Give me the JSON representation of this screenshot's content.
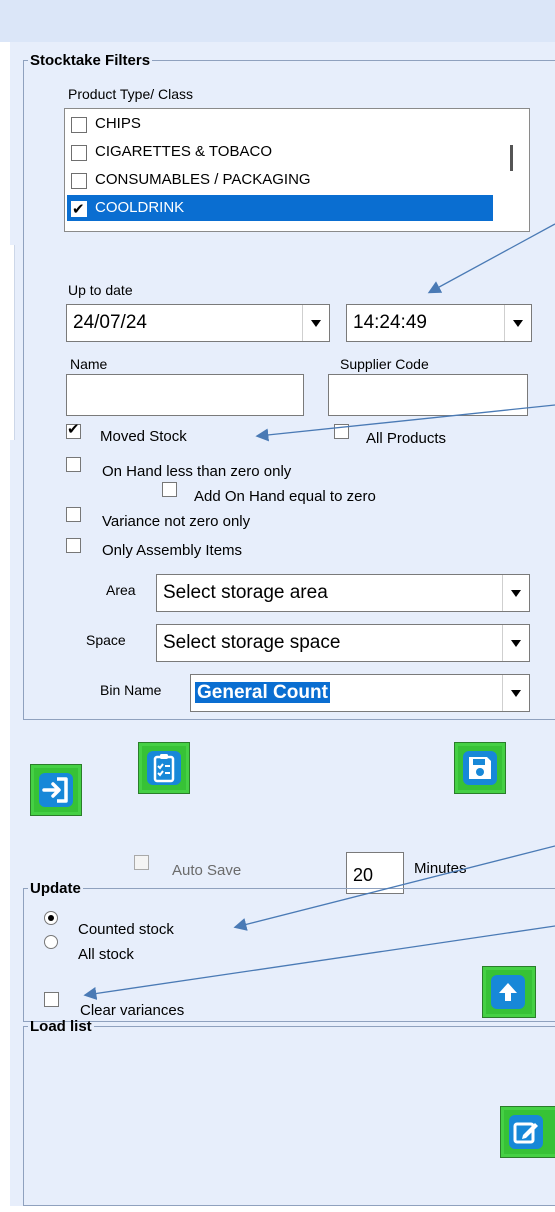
{
  "filters": {
    "legend": "Stocktake Filters",
    "product_type_label": "Product Type/ Class",
    "product_types": [
      {
        "label": "CHIPS",
        "checked": false,
        "selected": false
      },
      {
        "label": "CIGARETTES & TOBACO",
        "checked": false,
        "selected": false
      },
      {
        "label": "CONSUMABLES / PACKAGING",
        "checked": false,
        "selected": false
      },
      {
        "label": "COOLDRINK",
        "checked": true,
        "selected": true
      }
    ],
    "up_to_date_label": "Up to date",
    "date_value": "24/07/24",
    "time_value": "14:24:49",
    "name_label": "Name",
    "name_value": "",
    "supplier_code_label": "Supplier Code",
    "supplier_code_value": "",
    "options": {
      "moved_stock": {
        "label": "Moved Stock",
        "checked": true
      },
      "all_products": {
        "label": "All Products",
        "checked": false
      },
      "on_hand_less_zero": {
        "label": "On Hand less than zero only",
        "checked": false
      },
      "add_on_hand_zero": {
        "label": "Add On Hand equal to zero",
        "checked": false
      },
      "variance_not_zero": {
        "label": "Variance not zero only",
        "checked": false
      },
      "only_assembly": {
        "label": "Only Assembly Items",
        "checked": false
      }
    },
    "area_label": "Area",
    "area_value": "Select storage area",
    "space_label": "Space",
    "space_value": "Select storage space",
    "bin_name_label": "Bin Name",
    "bin_name_value": "General Count"
  },
  "toolbar": {
    "buttons": [
      {
        "name": "import-button",
        "icon": "sign-in-icon"
      },
      {
        "name": "checklist-button",
        "icon": "clipboard-checklist-icon"
      },
      {
        "name": "save-button",
        "icon": "floppy-disk-icon"
      }
    ]
  },
  "autosave": {
    "label": "Auto Save",
    "checked": false,
    "minutes_value": "20",
    "minutes_label": "Minutes"
  },
  "update": {
    "legend": "Update",
    "counted_stock_label": "Counted stock",
    "all_stock_label": "All stock",
    "selected": "counted",
    "clear_variances_label": "Clear variances",
    "clear_variances_checked": false,
    "upload_icon": "upload-icon"
  },
  "load_list": {
    "legend": "Load list",
    "edit_icon": "edit-icon"
  },
  "colors": {
    "panel_bg": "#e7eefb",
    "selection": "#0a6ed1",
    "button_green": "#37c236",
    "icon_blue": "#1788d8",
    "arrow": "#4a7ab5"
  }
}
